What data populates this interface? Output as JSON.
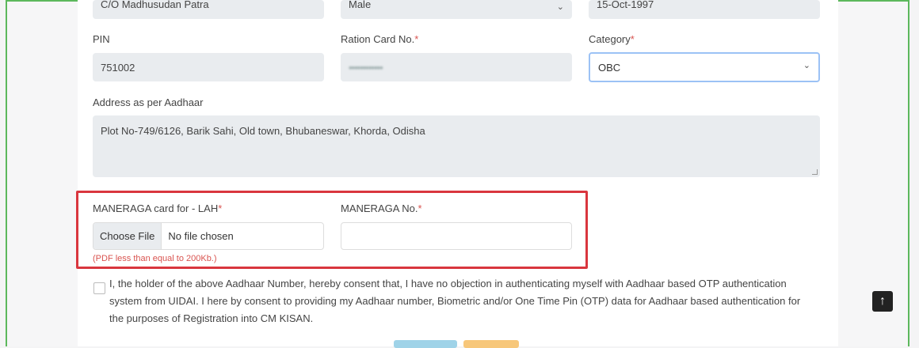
{
  "top_row": {
    "guardian_value": "C/O Madhusudan Patra",
    "gender_value": "Male",
    "dob_value": "15-Oct-1997"
  },
  "pin": {
    "label": "PIN",
    "value": "751002"
  },
  "ration": {
    "label": "Ration Card No.",
    "required": "*",
    "value": "••••••••••••"
  },
  "category": {
    "label": "Category",
    "required": "*",
    "value": "OBC"
  },
  "address": {
    "label": "Address as per Aadhaar",
    "value": "Plot No-749/6126, Barik Sahi, Old town, Bhubaneswar, Khorda, Odisha"
  },
  "maneraga_card": {
    "label": "MANERAGA card for - LAH",
    "required": "*",
    "choose_file": "Choose File",
    "no_file": "No file chosen",
    "hint": "(PDF less than equal to 200Kb.)"
  },
  "maneraga_no": {
    "label": "MANERAGA No.",
    "required": "*",
    "value": ""
  },
  "consent_text": "I, the holder of the above Aadhaar Number, hereby consent that, I have no objection in authenticating myself with Aadhaar based OTP authentication system from UIDAI. I here by consent to providing my Aadhaar number, Biometric and/or One Time Pin (OTP) data for Aadhaar based authentication for the purposes of Registration into CM KISAN.",
  "colors": {
    "frame": "#5cb85c",
    "highlight": "#d9363e",
    "required": "#d9534f",
    "focus": "#9cc2f5"
  },
  "icons": {
    "scroll_top": "arrow-up-icon",
    "select": "chevron-down-icon"
  }
}
